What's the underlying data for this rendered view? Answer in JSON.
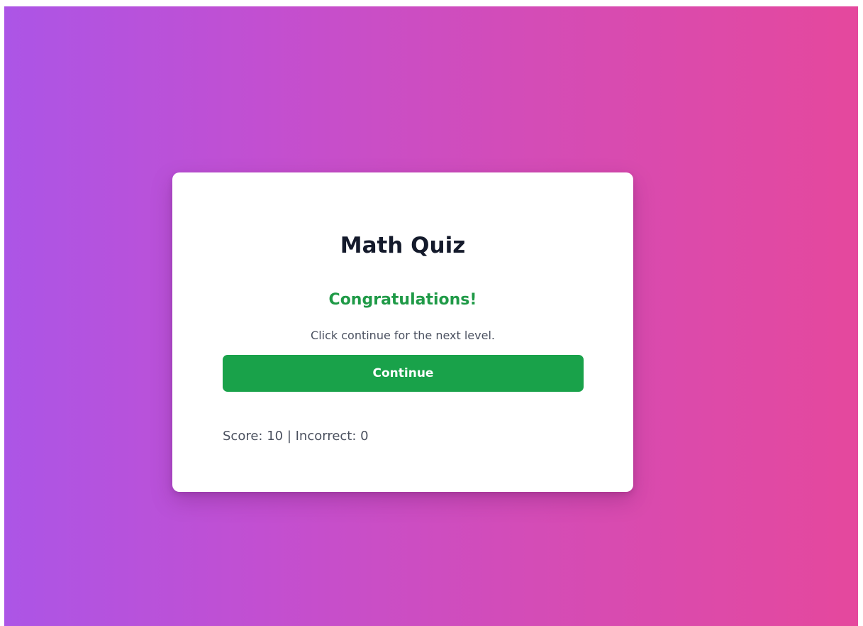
{
  "quiz": {
    "title": "Math Quiz",
    "message": "Congratulations!",
    "instructions": "Click continue for the next level.",
    "continue_label": "Continue",
    "score_text": "Score: 10 | Incorrect: 0"
  },
  "colors": {
    "gradient_start": "#ac55e6",
    "gradient_end": "#e5489d",
    "success_green": "#1f9a47",
    "button_green": "#19a24a",
    "title_text": "#141a2b"
  }
}
